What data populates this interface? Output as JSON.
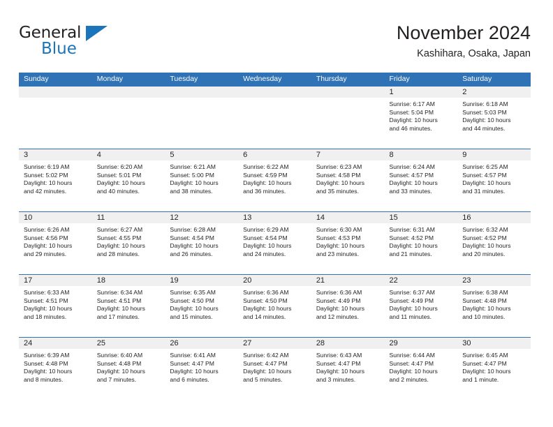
{
  "brand": {
    "word_one": "General",
    "word_two": "Blue"
  },
  "header": {
    "title": "November 2024",
    "subtitle": "Kashihara, Osaka, Japan"
  },
  "colors": {
    "header_blue": "#2f72b5",
    "brand_blue": "#1b75bb",
    "daynum_band": "#f0f0f0",
    "text": "#231f20"
  },
  "weekday_headers": [
    "Sunday",
    "Monday",
    "Tuesday",
    "Wednesday",
    "Thursday",
    "Friday",
    "Saturday"
  ],
  "weeks": [
    [
      {
        "day": "",
        "sunrise": "",
        "sunset": "",
        "daylight_1": "",
        "daylight_2": ""
      },
      {
        "day": "",
        "sunrise": "",
        "sunset": "",
        "daylight_1": "",
        "daylight_2": ""
      },
      {
        "day": "",
        "sunrise": "",
        "sunset": "",
        "daylight_1": "",
        "daylight_2": ""
      },
      {
        "day": "",
        "sunrise": "",
        "sunset": "",
        "daylight_1": "",
        "daylight_2": ""
      },
      {
        "day": "",
        "sunrise": "",
        "sunset": "",
        "daylight_1": "",
        "daylight_2": ""
      },
      {
        "day": "1",
        "sunrise": "Sunrise: 6:17 AM",
        "sunset": "Sunset: 5:04 PM",
        "daylight_1": "Daylight: 10 hours",
        "daylight_2": "and 46 minutes."
      },
      {
        "day": "2",
        "sunrise": "Sunrise: 6:18 AM",
        "sunset": "Sunset: 5:03 PM",
        "daylight_1": "Daylight: 10 hours",
        "daylight_2": "and 44 minutes."
      }
    ],
    [
      {
        "day": "3",
        "sunrise": "Sunrise: 6:19 AM",
        "sunset": "Sunset: 5:02 PM",
        "daylight_1": "Daylight: 10 hours",
        "daylight_2": "and 42 minutes."
      },
      {
        "day": "4",
        "sunrise": "Sunrise: 6:20 AM",
        "sunset": "Sunset: 5:01 PM",
        "daylight_1": "Daylight: 10 hours",
        "daylight_2": "and 40 minutes."
      },
      {
        "day": "5",
        "sunrise": "Sunrise: 6:21 AM",
        "sunset": "Sunset: 5:00 PM",
        "daylight_1": "Daylight: 10 hours",
        "daylight_2": "and 38 minutes."
      },
      {
        "day": "6",
        "sunrise": "Sunrise: 6:22 AM",
        "sunset": "Sunset: 4:59 PM",
        "daylight_1": "Daylight: 10 hours",
        "daylight_2": "and 36 minutes."
      },
      {
        "day": "7",
        "sunrise": "Sunrise: 6:23 AM",
        "sunset": "Sunset: 4:58 PM",
        "daylight_1": "Daylight: 10 hours",
        "daylight_2": "and 35 minutes."
      },
      {
        "day": "8",
        "sunrise": "Sunrise: 6:24 AM",
        "sunset": "Sunset: 4:57 PM",
        "daylight_1": "Daylight: 10 hours",
        "daylight_2": "and 33 minutes."
      },
      {
        "day": "9",
        "sunrise": "Sunrise: 6:25 AM",
        "sunset": "Sunset: 4:57 PM",
        "daylight_1": "Daylight: 10 hours",
        "daylight_2": "and 31 minutes."
      }
    ],
    [
      {
        "day": "10",
        "sunrise": "Sunrise: 6:26 AM",
        "sunset": "Sunset: 4:56 PM",
        "daylight_1": "Daylight: 10 hours",
        "daylight_2": "and 29 minutes."
      },
      {
        "day": "11",
        "sunrise": "Sunrise: 6:27 AM",
        "sunset": "Sunset: 4:55 PM",
        "daylight_1": "Daylight: 10 hours",
        "daylight_2": "and 28 minutes."
      },
      {
        "day": "12",
        "sunrise": "Sunrise: 6:28 AM",
        "sunset": "Sunset: 4:54 PM",
        "daylight_1": "Daylight: 10 hours",
        "daylight_2": "and 26 minutes."
      },
      {
        "day": "13",
        "sunrise": "Sunrise: 6:29 AM",
        "sunset": "Sunset: 4:54 PM",
        "daylight_1": "Daylight: 10 hours",
        "daylight_2": "and 24 minutes."
      },
      {
        "day": "14",
        "sunrise": "Sunrise: 6:30 AM",
        "sunset": "Sunset: 4:53 PM",
        "daylight_1": "Daylight: 10 hours",
        "daylight_2": "and 23 minutes."
      },
      {
        "day": "15",
        "sunrise": "Sunrise: 6:31 AM",
        "sunset": "Sunset: 4:52 PM",
        "daylight_1": "Daylight: 10 hours",
        "daylight_2": "and 21 minutes."
      },
      {
        "day": "16",
        "sunrise": "Sunrise: 6:32 AM",
        "sunset": "Sunset: 4:52 PM",
        "daylight_1": "Daylight: 10 hours",
        "daylight_2": "and 20 minutes."
      }
    ],
    [
      {
        "day": "17",
        "sunrise": "Sunrise: 6:33 AM",
        "sunset": "Sunset: 4:51 PM",
        "daylight_1": "Daylight: 10 hours",
        "daylight_2": "and 18 minutes."
      },
      {
        "day": "18",
        "sunrise": "Sunrise: 6:34 AM",
        "sunset": "Sunset: 4:51 PM",
        "daylight_1": "Daylight: 10 hours",
        "daylight_2": "and 17 minutes."
      },
      {
        "day": "19",
        "sunrise": "Sunrise: 6:35 AM",
        "sunset": "Sunset: 4:50 PM",
        "daylight_1": "Daylight: 10 hours",
        "daylight_2": "and 15 minutes."
      },
      {
        "day": "20",
        "sunrise": "Sunrise: 6:36 AM",
        "sunset": "Sunset: 4:50 PM",
        "daylight_1": "Daylight: 10 hours",
        "daylight_2": "and 14 minutes."
      },
      {
        "day": "21",
        "sunrise": "Sunrise: 6:36 AM",
        "sunset": "Sunset: 4:49 PM",
        "daylight_1": "Daylight: 10 hours",
        "daylight_2": "and 12 minutes."
      },
      {
        "day": "22",
        "sunrise": "Sunrise: 6:37 AM",
        "sunset": "Sunset: 4:49 PM",
        "daylight_1": "Daylight: 10 hours",
        "daylight_2": "and 11 minutes."
      },
      {
        "day": "23",
        "sunrise": "Sunrise: 6:38 AM",
        "sunset": "Sunset: 4:48 PM",
        "daylight_1": "Daylight: 10 hours",
        "daylight_2": "and 10 minutes."
      }
    ],
    [
      {
        "day": "24",
        "sunrise": "Sunrise: 6:39 AM",
        "sunset": "Sunset: 4:48 PM",
        "daylight_1": "Daylight: 10 hours",
        "daylight_2": "and 8 minutes."
      },
      {
        "day": "25",
        "sunrise": "Sunrise: 6:40 AM",
        "sunset": "Sunset: 4:48 PM",
        "daylight_1": "Daylight: 10 hours",
        "daylight_2": "and 7 minutes."
      },
      {
        "day": "26",
        "sunrise": "Sunrise: 6:41 AM",
        "sunset": "Sunset: 4:47 PM",
        "daylight_1": "Daylight: 10 hours",
        "daylight_2": "and 6 minutes."
      },
      {
        "day": "27",
        "sunrise": "Sunrise: 6:42 AM",
        "sunset": "Sunset: 4:47 PM",
        "daylight_1": "Daylight: 10 hours",
        "daylight_2": "and 5 minutes."
      },
      {
        "day": "28",
        "sunrise": "Sunrise: 6:43 AM",
        "sunset": "Sunset: 4:47 PM",
        "daylight_1": "Daylight: 10 hours",
        "daylight_2": "and 3 minutes."
      },
      {
        "day": "29",
        "sunrise": "Sunrise: 6:44 AM",
        "sunset": "Sunset: 4:47 PM",
        "daylight_1": "Daylight: 10 hours",
        "daylight_2": "and 2 minutes."
      },
      {
        "day": "30",
        "sunrise": "Sunrise: 6:45 AM",
        "sunset": "Sunset: 4:47 PM",
        "daylight_1": "Daylight: 10 hours",
        "daylight_2": "and 1 minute."
      }
    ]
  ]
}
